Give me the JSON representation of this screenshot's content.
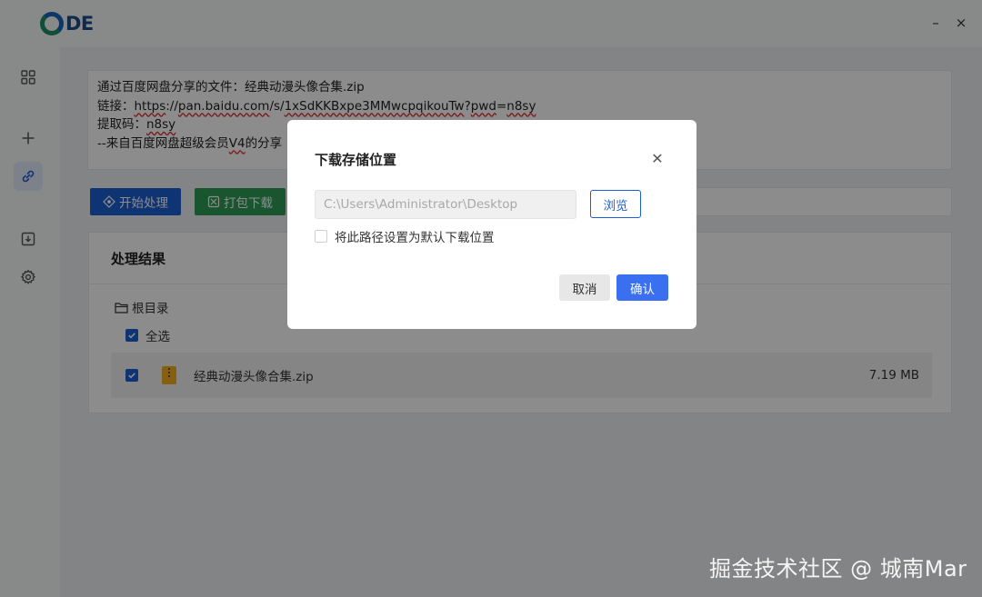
{
  "app": {
    "logo_text": "DE"
  },
  "window": {
    "minimize_glyph": "–",
    "close_glyph": "×"
  },
  "sidebar": {
    "items": [
      {
        "name": "dashboard",
        "icon": "grid-icon"
      },
      {
        "name": "add",
        "icon": "plus-icon"
      },
      {
        "name": "link",
        "icon": "link-icon",
        "active": true
      },
      {
        "name": "download",
        "icon": "download-icon"
      },
      {
        "name": "settings",
        "icon": "gear-icon"
      }
    ]
  },
  "share": {
    "line1": "通过百度网盘分享的文件：经典动漫头像合集.zip",
    "link_prefix": "链接：",
    "link_url_a": "https",
    "link_url_b": "://",
    "link_url_c": "pan.baidu.com",
    "link_url_d": "/s/",
    "link_url_e": "1xSdKKBxpe3MMwcpqikouTw",
    "link_url_f": "?",
    "link_url_g": "pwd",
    "link_url_h": "=",
    "link_url_i": "n8sy",
    "code_prefix": "提取码：",
    "code_value": "n8sy",
    "footer_prefix": "--来自百度网盘超级会员",
    "footer_vip": "V4",
    "footer_suffix": "的分享"
  },
  "toolbar": {
    "process_label": "开始处理",
    "pack_label": "打包下载"
  },
  "result": {
    "title": "处理结果",
    "root_label": "根目录",
    "select_all_label": "全选",
    "files": [
      {
        "name": "经典动漫头像合集.zip",
        "size": "7.19 MB",
        "checked": true
      }
    ]
  },
  "dialog": {
    "title": "下载存储位置",
    "path_value": "C:\\Users\\Administrator\\Desktop",
    "browse_label": "浏览",
    "default_label": "将此路径设置为默认下载位置",
    "default_checked": false,
    "cancel_label": "取消",
    "ok_label": "确认"
  },
  "watermark": "掘金技术社区 @ 城南Mar",
  "colors": {
    "primary": "#1c5fd3",
    "ok_button": "#3a6ff0",
    "green": "#2f9d57"
  }
}
